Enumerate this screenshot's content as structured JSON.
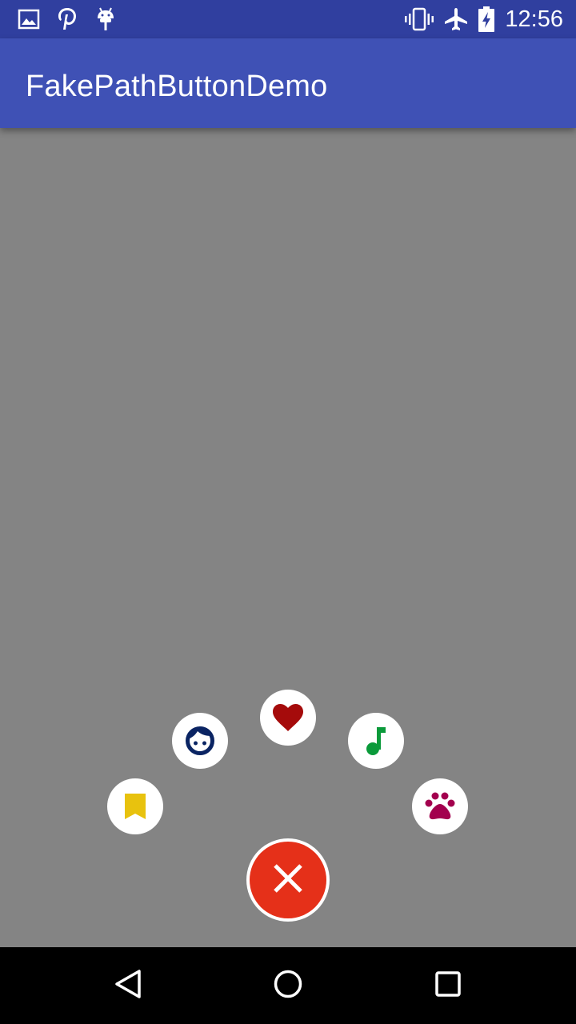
{
  "status_bar": {
    "time": "12:56",
    "background": "#303F9F",
    "left_icons": [
      "image-icon",
      "pinterest-icon",
      "android-icon"
    ],
    "right_icons": [
      "vibrate-icon",
      "airplane-mode-icon",
      "battery-charging-icon"
    ]
  },
  "app_bar": {
    "title": "FakePathButtonDemo",
    "background": "#3F51B5"
  },
  "content": {
    "background": "#848484"
  },
  "path_menu": {
    "main_button": {
      "icon": "close-icon",
      "color": "#E53019"
    },
    "items": [
      {
        "icon": "bookmark-icon",
        "color": "#E8C20E"
      },
      {
        "icon": "face-icon",
        "color": "#0A2463"
      },
      {
        "icon": "heart-icon",
        "color": "#A50B0B"
      },
      {
        "icon": "music-note-icon",
        "color": "#0A9A3A"
      },
      {
        "icon": "paw-icon",
        "color": "#A3004E"
      }
    ]
  },
  "nav_bar": {
    "buttons": [
      "back-icon",
      "home-icon",
      "recents-icon"
    ]
  }
}
